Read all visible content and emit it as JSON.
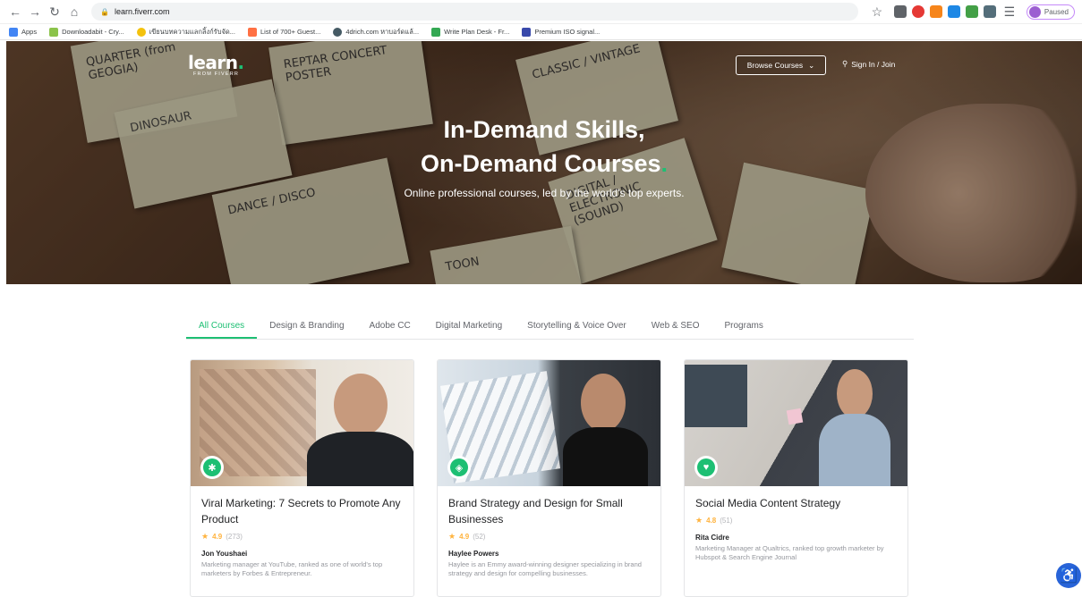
{
  "browser": {
    "url": "learn.fiverr.com",
    "profile_status": "Paused",
    "bookmarks": [
      {
        "label": "Apps",
        "color": "#4285f4"
      },
      {
        "label": "Downloadabit - Cry...",
        "color": "#8bc34a"
      },
      {
        "label": "เขียนบทความแลกลิ้งก์รับจัด...",
        "color": "#f4c20d"
      },
      {
        "label": "List of 700+ Guest...",
        "color": "#ff7043"
      },
      {
        "label": "4drich.com หาบอร์ดแล้...",
        "color": "#455a64"
      },
      {
        "label": "Write Plan Desk - Fr...",
        "color": "#34a853"
      },
      {
        "label": "Premium ISO signal...",
        "color": "#3949ab"
      }
    ]
  },
  "header": {
    "logo_main": "learn",
    "logo_dot": ".",
    "logo_sub": "FROM FIVERR",
    "browse_label": "Browse Courses",
    "signin_label": "Sign In / Join"
  },
  "hero": {
    "title_line1": "In-Demand Skills,",
    "title_line2": "On-Demand Courses",
    "title_dot": ".",
    "subtitle": "Online professional courses, led by the world's top experts.",
    "notes": [
      "QUARTER (from GEOGIA)",
      "REPTAR CONCERT POSTER",
      "CLASSIC / VINTAGE",
      "DINOSAUR",
      "DANCE / DISCO",
      "DIGITAL / ELECTRONIC (SOUND)",
      "TOON"
    ]
  },
  "tabs": [
    "All Courses",
    "Design & Branding",
    "Adobe CC",
    "Digital Marketing",
    "Storytelling & Voice Over",
    "Web & SEO",
    "Programs"
  ],
  "courses": [
    {
      "title": "Viral Marketing: 7 Secrets to Promote Any Product",
      "rating": "4.9",
      "count": "(273)",
      "author": "Jon Youshaei",
      "description": "Marketing manager at YouTube, ranked as one of world's top marketers by Forbes & Entrepreneur.",
      "badge_icon": "asterisk-icon",
      "badge_glyph": "✱"
    },
    {
      "title": "Brand Strategy and Design for Small Businesses",
      "rating": "4.9",
      "count": "(52)",
      "author": "Haylee Powers",
      "description": "Haylee is an Emmy award-winning designer specializing in brand strategy and design for compelling businesses.",
      "badge_icon": "tag-icon",
      "badge_glyph": "◈"
    },
    {
      "title": "Social Media Content Strategy",
      "rating": "4.8",
      "count": "(51)",
      "author": "Rita Cidre",
      "description": "Marketing Manager at Qualtrics, ranked top growth marketer by Hubspot & Search Engine Journal",
      "badge_icon": "heart-chat-icon",
      "badge_glyph": "♥"
    }
  ],
  "accent_color": "#1dbf73"
}
